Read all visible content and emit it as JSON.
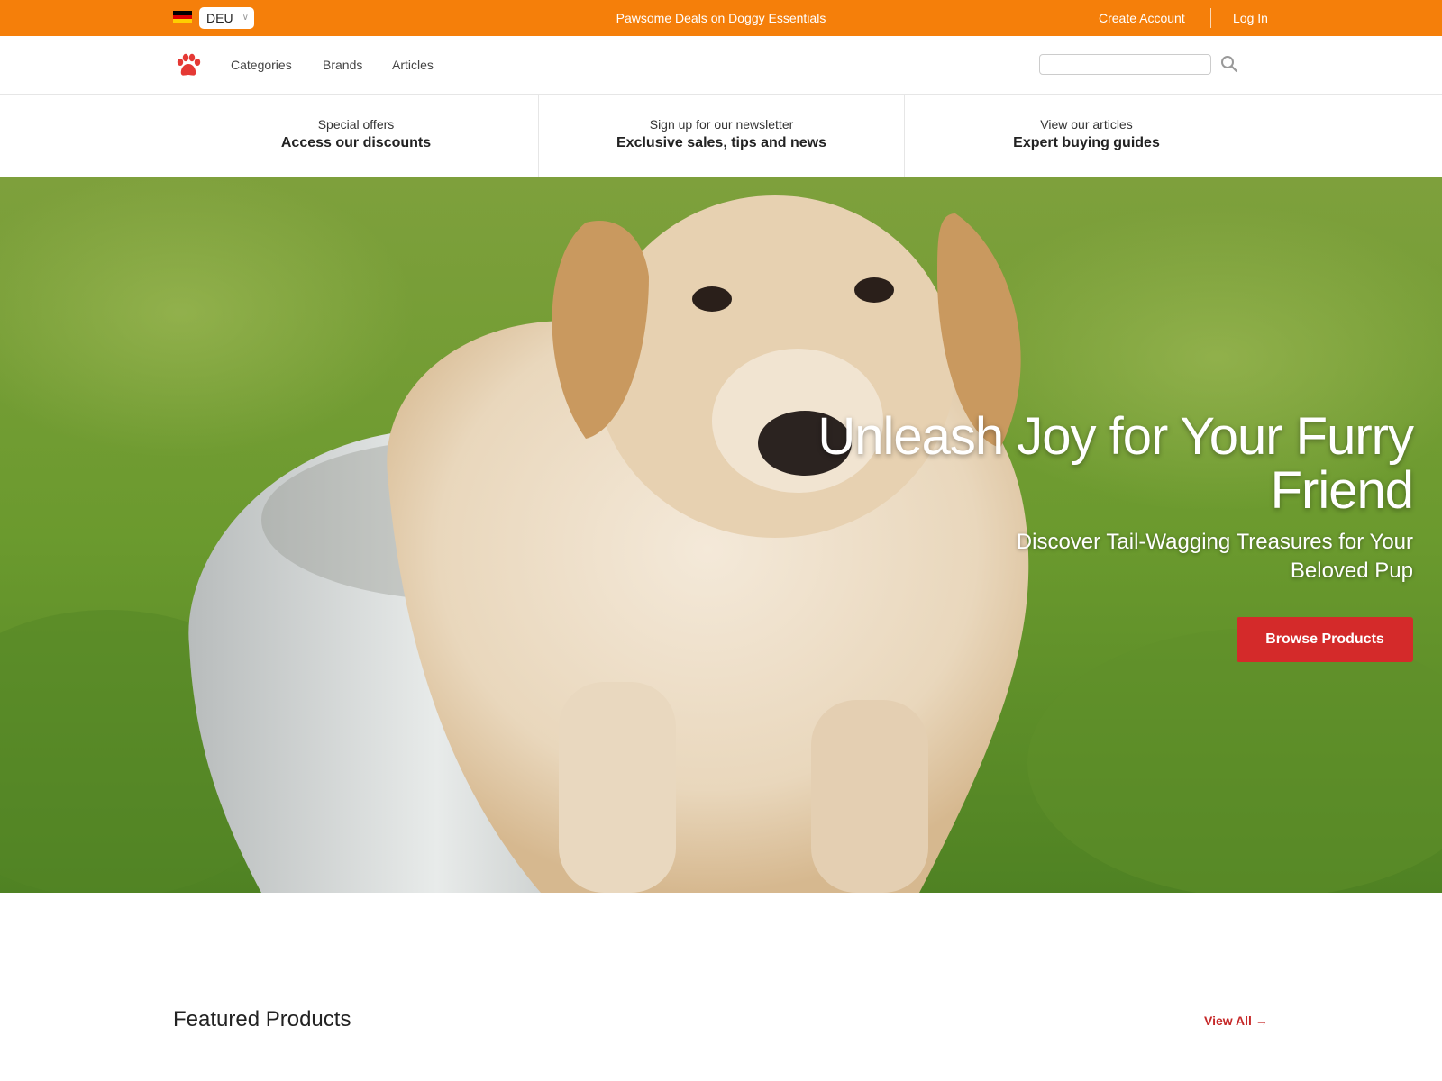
{
  "topbar": {
    "promo": "Pawsome Deals on Doggy Essentials",
    "language": "DEU",
    "create_account": "Create Account",
    "login": "Log In",
    "background_color": "#f57f0a"
  },
  "nav": {
    "logo_icon": "paw-icon",
    "links": [
      "Categories",
      "Brands",
      "Articles"
    ],
    "search": {
      "value": "",
      "placeholder": "",
      "icon": "search-icon"
    }
  },
  "promo_strip": [
    {
      "small": "Special offers",
      "big": "Access our discounts"
    },
    {
      "small": "Sign up for our newsletter",
      "big": "Exclusive sales, tips and news"
    },
    {
      "small": "View our articles",
      "big": "Expert buying guides"
    }
  ],
  "hero": {
    "title": "Unleash Joy for Your Furry Friend",
    "subtitle": "Discover Tail-Wagging Treasures for Your Beloved Pup",
    "cta": "Browse Products",
    "cta_color": "#d42a2a"
  },
  "featured": {
    "title": "Featured Products",
    "view_all": "View All →"
  }
}
